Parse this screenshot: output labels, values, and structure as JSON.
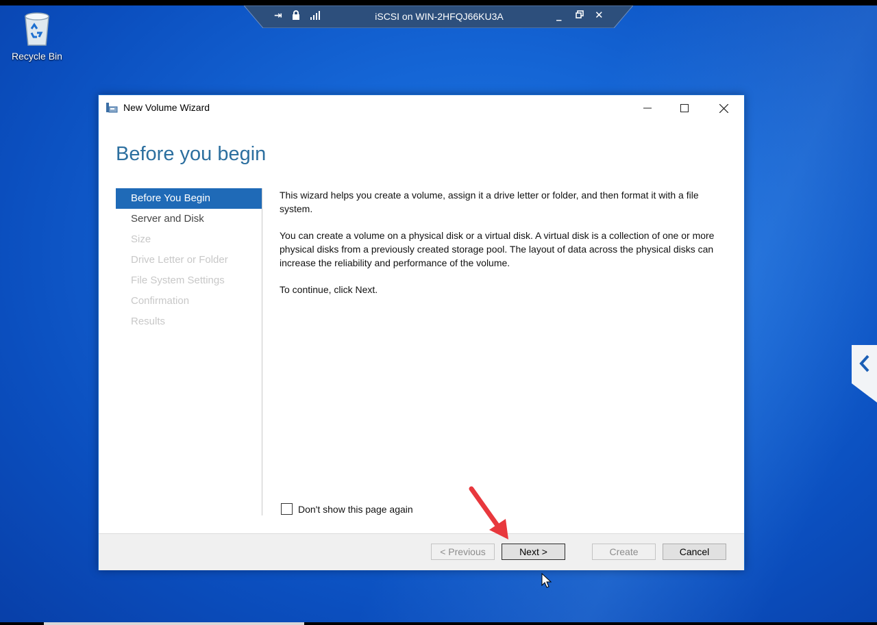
{
  "rdp_bar": {
    "title": "iSCSI on WIN-2HFQJ66KU3A",
    "icons": [
      "pin-icon",
      "lock-icon",
      "signal-icon"
    ],
    "buttons": [
      "minimize",
      "restore",
      "close"
    ]
  },
  "desktop": {
    "recycle_bin_label": "Recycle Bin"
  },
  "window": {
    "title": "New Volume Wizard",
    "heading": "Before you begin"
  },
  "nav": {
    "items": [
      {
        "label": "Before You Begin",
        "state": "active"
      },
      {
        "label": "Server and Disk",
        "state": "enabled"
      },
      {
        "label": "Size",
        "state": "disabled"
      },
      {
        "label": "Drive Letter or Folder",
        "state": "disabled"
      },
      {
        "label": "File System Settings",
        "state": "disabled"
      },
      {
        "label": "Confirmation",
        "state": "disabled"
      },
      {
        "label": "Results",
        "state": "disabled"
      }
    ]
  },
  "content": {
    "paragraphs": [
      "This wizard helps you create a volume, assign it a drive letter or folder, and then format it with a file system.",
      "You can create a volume on a physical disk or a virtual disk. A virtual disk is a collection of one or more physical disks from a previously created storage pool. The layout of data across the physical disks can increase the reliability and performance of the volume.",
      "To continue, click Next."
    ],
    "dont_show_label": "Don't show this page again",
    "dont_show_checked": false
  },
  "footer": {
    "previous_label": "< Previous",
    "next_label": "Next >",
    "create_label": "Create",
    "cancel_label": "Cancel"
  },
  "colors": {
    "accent": "#1f6ab7",
    "heading": "#2c6f9f",
    "annotation_arrow": "#e8383d"
  }
}
